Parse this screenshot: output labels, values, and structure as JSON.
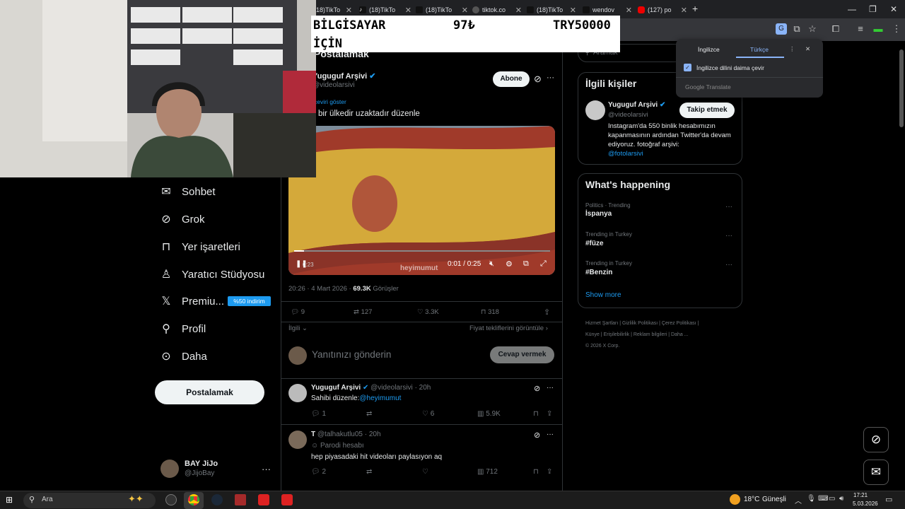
{
  "browser": {
    "tabs": [
      {
        "label": "(18)TikTo"
      },
      {
        "label": "(18)TikTo"
      },
      {
        "label": "(18)TikTo"
      },
      {
        "label": "tiktok.co"
      },
      {
        "label": "(18)TikTo"
      },
      {
        "label": "wendov"
      },
      {
        "label": "(127) po"
      }
    ],
    "new_tab": "+"
  },
  "banner": {
    "line1": "BİLGİSAYAR",
    "line2": "İÇİN",
    "price": "97₺",
    "goal": "TRY50000"
  },
  "translate": {
    "lang_from": "İngilizce",
    "lang_to": "Türkçe",
    "always_label": "İngilizce dilini daima çevir",
    "brand": "Google Translate"
  },
  "nav": {
    "items": [
      {
        "label": "Sohbet",
        "icon": "mail-icon"
      },
      {
        "label": "Grok",
        "icon": "grok-icon"
      },
      {
        "label": "Yer işaretleri",
        "icon": "bookmark-icon"
      },
      {
        "label": "Yaratıcı Stüdyosu",
        "icon": "studio-icon"
      },
      {
        "label": "Premiu...",
        "icon": "x-logo-icon"
      },
      {
        "label": "Profil",
        "icon": "person-icon"
      },
      {
        "label": "Daha",
        "icon": "more-circle-icon"
      }
    ],
    "premium_badge": "%50 indirim",
    "post_button": "Postalamak",
    "account_name": "BAY JiJo",
    "account_handle": "@JijoBay"
  },
  "post": {
    "header_title": "Postalamak",
    "author_name": "Yuguguf Arşivi",
    "author_handle": "@videolarsivi",
    "follow_button": "Abone",
    "show_translation": "çeviri göster",
    "text": "bir ülkedir uzaktadır düzenle",
    "video_time": "0:01 / 0:25",
    "video_watermark": "heyimumut",
    "video_counter": "0:23",
    "timestamp": "20:26 · 4 Mart 2026 ·",
    "views_count": "69.3K",
    "views_label": "Görüşler",
    "replies": "9",
    "reposts": "127",
    "likes": "3.3K",
    "bookmarks": "318",
    "relevant": "İlgili",
    "quote_offers": "Fiyat tekliflerini görüntüle",
    "reply_placeholder": "Yanıtınızı gönderin",
    "reply_button": "Cevap vermek"
  },
  "replies": [
    {
      "name": "Yuguguf Arşivi",
      "handle": "@videolarsivi",
      "time": "· 20h",
      "text": "Sahibi düzenle:",
      "mention": "@heyimumut",
      "replies": "1",
      "likes": "6",
      "views": "5.9K"
    },
    {
      "name": "T",
      "handle": "@talhakutlu05",
      "time": "· 20h",
      "parody": "Parodi hesabı",
      "text": "hep piyasadaki hit videoları paylasıyon aq",
      "replies": "2",
      "likes": "",
      "views": "712"
    }
  ],
  "right": {
    "search_placeholder": "Aramak",
    "related_title": "İlgili kişiler",
    "related_name": "Yuguguf Arşivi",
    "related_handle": "@videolarsivi",
    "related_follow": "Takip etmek",
    "related_bio": "Instagram'da 550 binlik hesabımızın kapanmasının ardından Twitter'da devam ediyoruz. fotoğraf arşivi:",
    "related_link": "@fotolarsivi",
    "happening_title": "What's happening",
    "trends": [
      {
        "context": "Politics · Trending",
        "topic": "İspanya"
      },
      {
        "context": "Trending in Turkey",
        "topic": "#füze"
      },
      {
        "context": "Trending in Turkey",
        "topic": "#Benzin"
      }
    ],
    "show_more": "Show more",
    "footer": [
      "Hizmet Şartları",
      "Gizlilik Politikası",
      "Çerez Politikası",
      "Künye",
      "Erişilebilirlik",
      "Reklam bilgileri",
      "Daha ..."
    ],
    "copyright": "© 2026 X Corp."
  },
  "taskbar": {
    "search": "Ara",
    "weather": "18°C",
    "weather_desc": "Güneşli",
    "time": "17:21",
    "date": "5.03.2026"
  }
}
